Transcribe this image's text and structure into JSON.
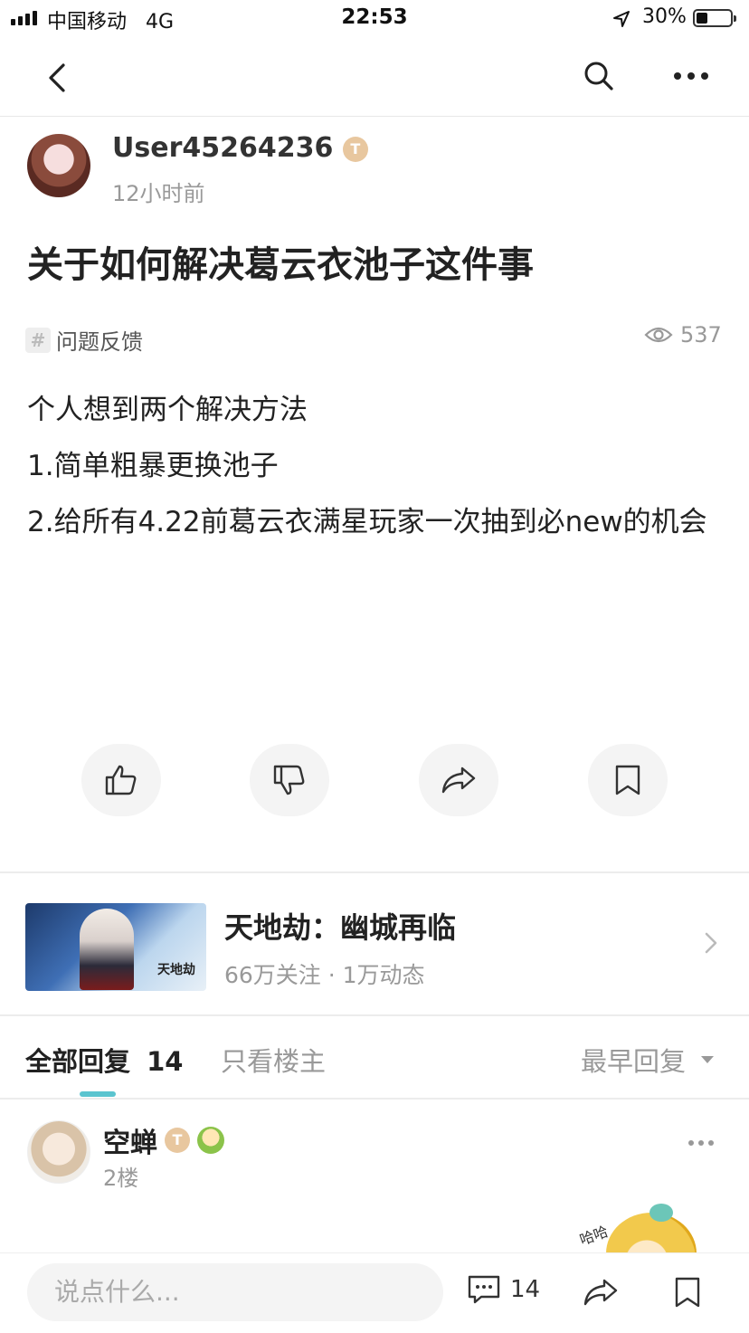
{
  "status_bar": {
    "carrier": "中国移动",
    "network": "4G",
    "time": "22:53",
    "battery": "30%"
  },
  "nav": {
    "back_icon": "chevron-left-icon",
    "search_icon": "search-icon",
    "more_icon": "more-horizontal-icon"
  },
  "post": {
    "author": "User45264236",
    "author_badge": "T",
    "time_ago": "12小时前",
    "title": "关于如何解决葛云衣池子这件事",
    "tag": "问题反馈",
    "views": "537",
    "content": [
      "个人想到两个解决方法",
      "1.简单粗暴更换池子",
      "2.给所有4.22前葛云衣满星玩家一次抽到必new的机会"
    ]
  },
  "actions": [
    "like-icon",
    "dislike-icon",
    "share-icon",
    "bookmark-icon"
  ],
  "game": {
    "name": "天地劫：幽城再临",
    "stats": "66万关注 · 1万动态",
    "logo_text": "天地劫"
  },
  "tabs": {
    "all_label": "全部回复",
    "all_count": "14",
    "owner_only": "只看楼主",
    "sort": "最早回复"
  },
  "reply": {
    "name": "空蝉",
    "badge": "T",
    "floor": "2楼",
    "sticker_text": "哈哈"
  },
  "bottom_bar": {
    "placeholder": "说点什么...",
    "comment_count": "14"
  },
  "colors": {
    "accent": "#5bc4cf",
    "badge": "#e8c79f",
    "muted_text": "#999999"
  }
}
